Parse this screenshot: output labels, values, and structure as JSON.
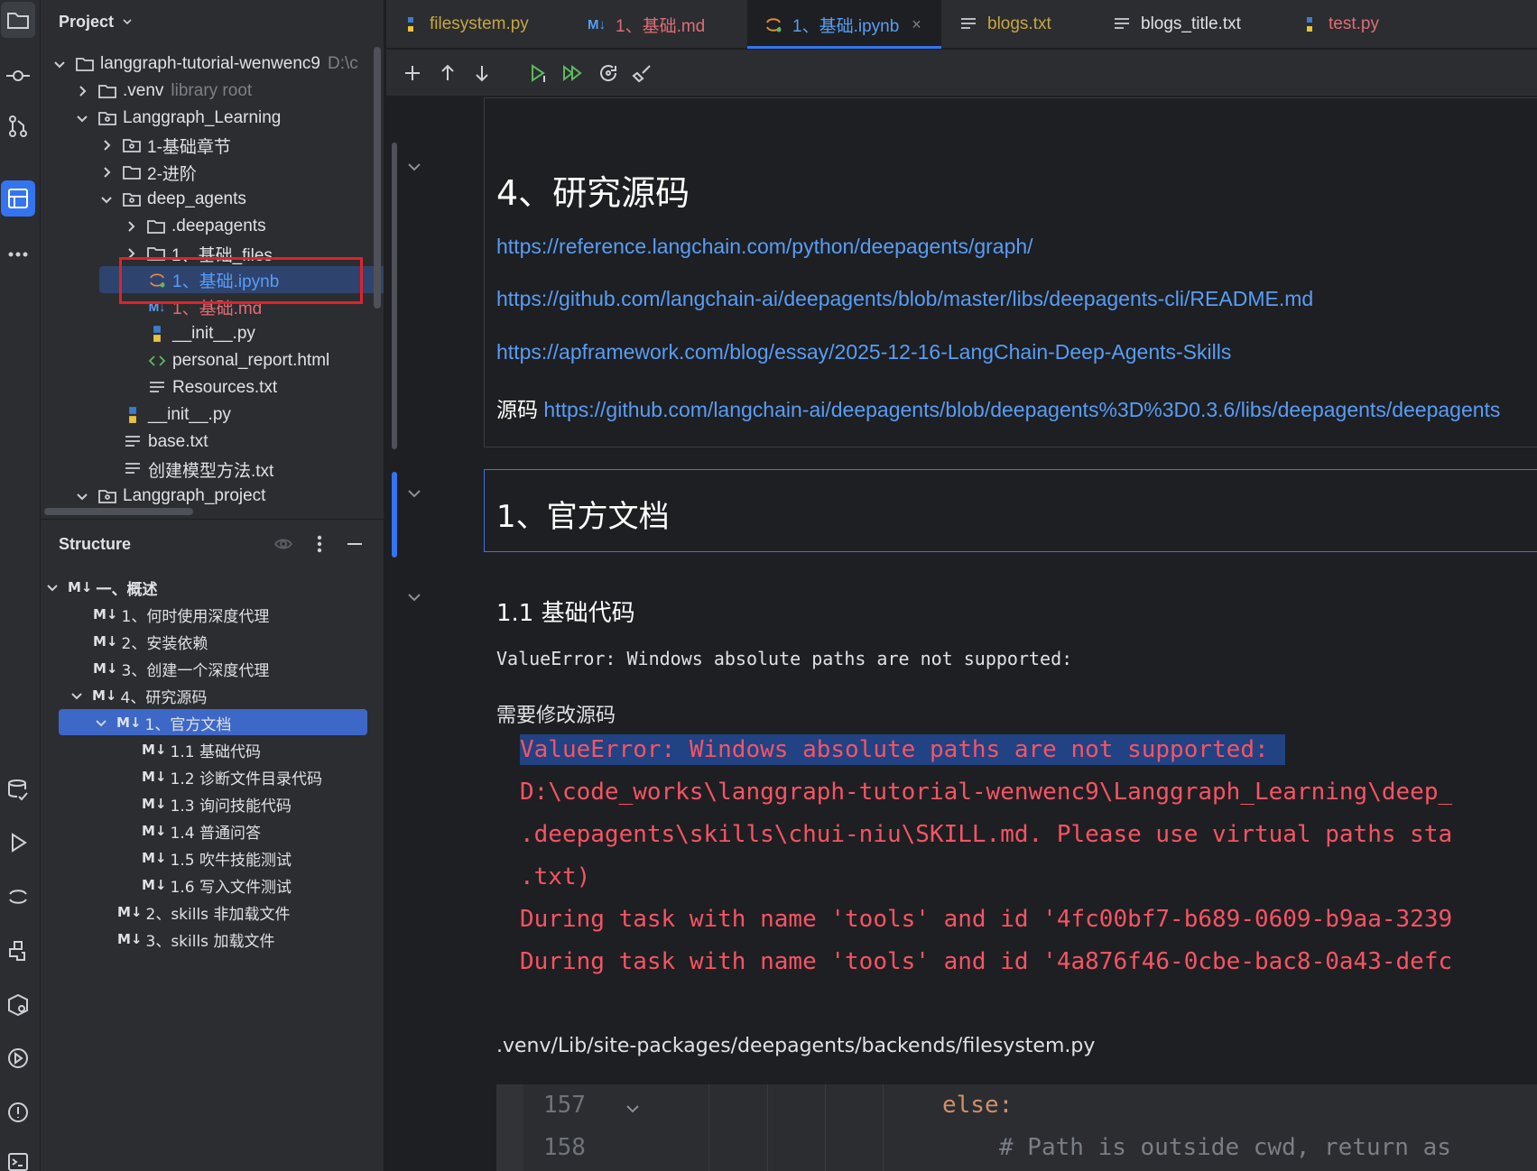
{
  "project_panel": {
    "title": "Project",
    "tree": [
      {
        "label": "langgraph-tutorial-wenwenc9",
        "suffix": "D:\\c"
      },
      {
        "label": ".venv",
        "suffix": "library root"
      },
      {
        "label": "Langgraph_Learning"
      },
      {
        "label": "1-基础章节"
      },
      {
        "label": "2-进阶"
      },
      {
        "label": "deep_agents"
      },
      {
        "label": ".deepagents"
      },
      {
        "label": "1、基础_files"
      },
      {
        "label": "1、基础.ipynb"
      },
      {
        "label": "1、基础.md"
      },
      {
        "label": "__init__.py"
      },
      {
        "label": "personal_report.html"
      },
      {
        "label": "Resources.txt"
      },
      {
        "label": "__init__.py"
      },
      {
        "label": "base.txt"
      },
      {
        "label": "创建模型方法.txt"
      },
      {
        "label": "Langgraph_project"
      }
    ]
  },
  "structure_panel": {
    "title": "Structure",
    "md_badge": "M↓",
    "items": [
      "一、概述",
      "1、何时使用深度代理",
      "2、安装依赖",
      "3、创建一个深度代理",
      "4、研究源码",
      "1、官方文档",
      "1.1 基础代码",
      "1.2 诊断文件目录代码",
      "1.3 询问技能代码",
      "1.4 普通问答",
      "1.5 吹牛技能测试",
      "1.6 写入文件测试",
      "2、skills 非加载文件",
      "3、skills 加载文件"
    ]
  },
  "tabs": [
    {
      "label": "filesystem.py",
      "color": "#c7a73e"
    },
    {
      "label": "1、基础.md",
      "color": "#e06c75"
    },
    {
      "label": "1、基础.ipynb",
      "color": "#589df6"
    },
    {
      "label": "blogs.txt",
      "color": "#c7a73e"
    },
    {
      "label": "blogs_title.txt",
      "color": "#dfe1e5"
    },
    {
      "label": "test.py",
      "color": "#e06c75"
    }
  ],
  "tab_close": "×",
  "editor": {
    "heading_research": "4、研究源码",
    "links": [
      "https://reference.langchain.com/python/deepagents/graph/",
      "https://github.com/langchain-ai/deepagents/blob/master/libs/deepagents-cli/README.md",
      "https://apframework.com/blog/essay/2025-12-16-LangChain-Deep-Agents-Skills"
    ],
    "source_label": "源码",
    "source_link": "https://github.com/langchain-ai/deepagents/blob/deepagents%3D%3D0.3.6/libs/deepagents/deepagents",
    "heading_official": "1、官方文档",
    "heading_basic": "1.1 基础代码",
    "value_error_plain": "ValueError: Windows absolute paths are not supported:",
    "need_modify": "需要修改源码",
    "error_lines": [
      "ValueError: Windows absolute paths are not supported:",
      "D:\\code_works\\langgraph-tutorial-wenwenc9\\Langgraph_Learning\\deep_",
      ".deepagents\\skills\\chui-niu\\SKILL.md. Please use virtual paths sta",
      ".txt)",
      "During task with name 'tools' and id '4fc00bf7-b689-0609-b9aa-3239",
      "During task with name 'tools' and id '4a876f46-0cbe-bac8-0a43-defc"
    ],
    "file_path": ".venv/Lib/site-packages/deepagents/backends/filesystem.py",
    "code": {
      "line_numbers": [
        "157",
        "158"
      ],
      "line1": "else:",
      "line2": "# Path is outside cwd, return as"
    }
  }
}
